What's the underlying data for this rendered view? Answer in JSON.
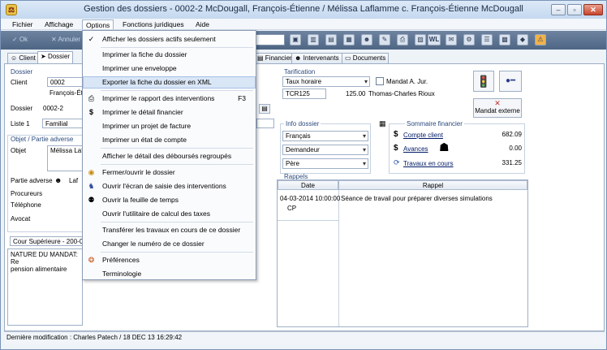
{
  "window": {
    "title": "Gestion des dossiers - 0002-2  McDougall, François-Étienne / Mélissa Laflamme c. François-Étienne McDougall"
  },
  "menubar": {
    "items": [
      "Fichier",
      "Affichage",
      "Options",
      "Fonctions juridiques",
      "Aide"
    ]
  },
  "toolbar": {
    "ok_label": "Ok",
    "cancel_label": "Annuler",
    "wl_label": "WL"
  },
  "tabs": [
    "Client",
    "Dossier",
    "Financier",
    "Intervenants",
    "Documents"
  ],
  "options_menu": [
    {
      "label": "Afficher les dossiers actifs seulement",
      "icon": "check-icon"
    },
    {
      "label": "Imprimer la fiche du dossier",
      "icon": ""
    },
    {
      "label": "Imprimer une enveloppe",
      "icon": ""
    },
    {
      "label": "Exporter la fiche du dossier en XML",
      "icon": ""
    },
    {
      "label": "Imprimer le rapport des interventions",
      "icon": "printer-icon",
      "shortcut": "F3"
    },
    {
      "label": "Imprimer le détail financier",
      "icon": "dollar-icon"
    },
    {
      "label": "Imprimer un projet de facture",
      "icon": ""
    },
    {
      "label": "Imprimer un état de compte",
      "icon": ""
    },
    {
      "label": "Afficher le détail des déboursés regroupés",
      "icon": ""
    },
    {
      "label": "Fermer/ouvrir le dossier",
      "icon": "folder-lock-icon"
    },
    {
      "label": "Ouvrir l'écran de saisie des interventions",
      "icon": "person-run-icon"
    },
    {
      "label": "Ouvrir la feuille de temps",
      "icon": "timesheet-icon"
    },
    {
      "label": "Ouvrir l'utilitaire de calcul des taxes",
      "icon": ""
    },
    {
      "label": "Transférer les travaux en cours de ce dossier",
      "icon": ""
    },
    {
      "label": "Changer le numéro de ce dossier",
      "icon": ""
    },
    {
      "label": "Préférences",
      "icon": "preferences-icon"
    },
    {
      "label": "Terminologie",
      "icon": ""
    }
  ],
  "left_panel": {
    "dossier_group": "Dossier",
    "client_label": "Client",
    "client_value": "0002",
    "client_name": "François-Éti",
    "dossier_label": "Dossier",
    "dossier_value": "0002-2",
    "liste_label": "Liste 1",
    "liste_value": "Familial",
    "objet_group": "Objet / Partie adverse",
    "objet_label": "Objet",
    "objet_value": "Mélissa Lafla",
    "partie_label": "Partie adverse",
    "partie_value": "Laf",
    "procureurs_label": "Procureurs",
    "telephone_label": "Téléphone",
    "avocat_label": "Avocat",
    "court_value": "Cour Supérieure - 200-0",
    "mandat_text_1": "NATURE DU MANDAT: Re",
    "mandat_text_2": "pension alimentaire"
  },
  "tarification": {
    "group": "Tarification",
    "mode": "Taux horaire",
    "code": "TCR125",
    "rate": "125.00",
    "person": "Thomas-Charles Rioux",
    "mandat_checkbox": "Mandat A. Jur.",
    "mandat_externe": "Mandat externe"
  },
  "info_dossier": {
    "group": "Info dossier",
    "langue": "Français",
    "role": "Demandeur",
    "parent": "Père"
  },
  "sommaire": {
    "group": "Sommaire financier",
    "rows": [
      {
        "label": "Compte client",
        "value": "682.09"
      },
      {
        "label": "Avances",
        "value": "0.00"
      },
      {
        "label": "Travaux en cours",
        "value": "331.25"
      }
    ]
  },
  "rappels": {
    "group": "Rappels",
    "col_date": "Date",
    "col_rappel": "Rappel",
    "rows": [
      {
        "date": "04-03-2014 10:00:00",
        "initials": "CP",
        "text": "Séance de travail pour préparer diverses simulations"
      }
    ]
  },
  "status": {
    "text": "Dernière modification : Charles Patech / 18 DEC 13  16:29:42"
  }
}
